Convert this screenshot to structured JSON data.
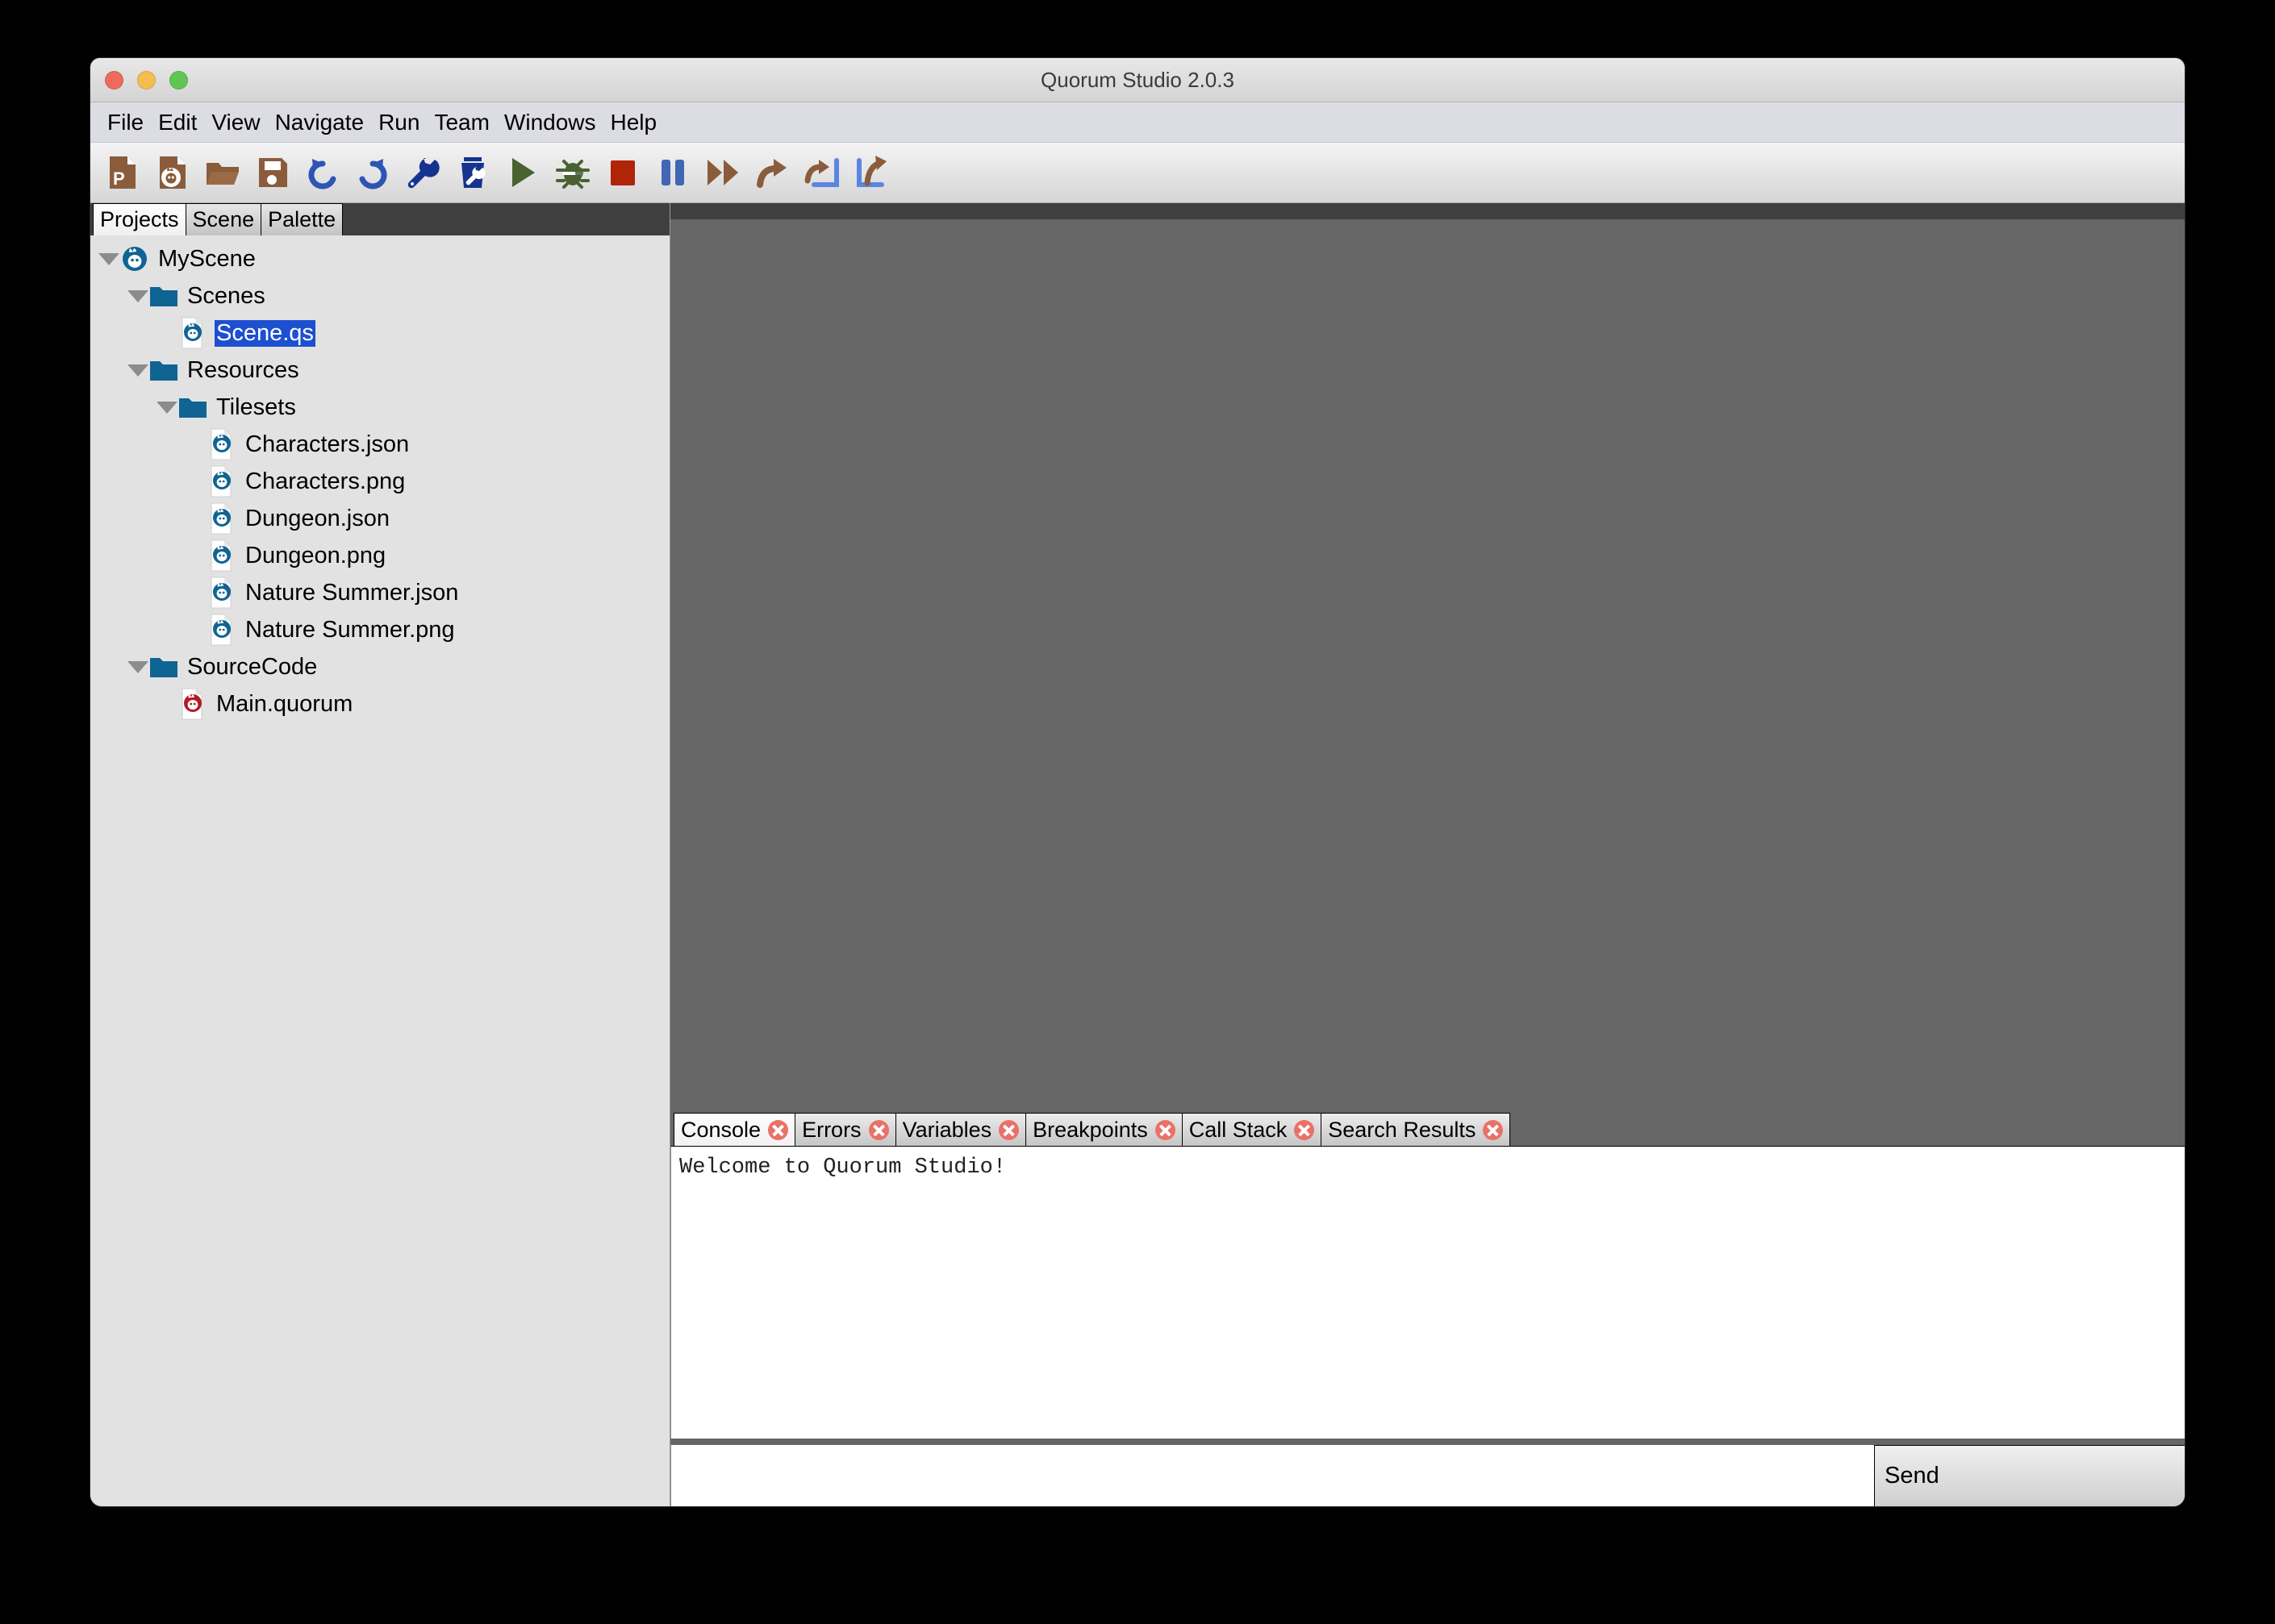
{
  "window": {
    "title": "Quorum Studio 2.0.3",
    "traffic_lights": [
      {
        "name": "close",
        "color": "#ee6a5f"
      },
      {
        "name": "minimize",
        "color": "#f5bd4f"
      },
      {
        "name": "maximize",
        "color": "#61c554"
      }
    ]
  },
  "menubar": {
    "items": [
      "File",
      "Edit",
      "View",
      "Navigate",
      "Run",
      "Team",
      "Windows",
      "Help"
    ]
  },
  "toolbar": {
    "buttons": [
      {
        "name": "new-project-icon",
        "tip": "New Project"
      },
      {
        "name": "new-file-icon",
        "tip": "New File"
      },
      {
        "name": "open-folder-icon",
        "tip": "Open Project"
      },
      {
        "name": "save-icon",
        "tip": "Save"
      },
      {
        "name": "undo-icon",
        "tip": "Undo"
      },
      {
        "name": "redo-icon",
        "tip": "Redo"
      },
      {
        "name": "build-wrench-icon",
        "tip": "Build"
      },
      {
        "name": "clean-build-icon",
        "tip": "Clean and Build"
      },
      {
        "name": "run-play-icon",
        "tip": "Run"
      },
      {
        "name": "debug-bug-icon",
        "tip": "Debug"
      },
      {
        "name": "stop-square-icon",
        "tip": "Stop"
      },
      {
        "name": "pause-icon",
        "tip": "Pause"
      },
      {
        "name": "continue-icon",
        "tip": "Continue"
      },
      {
        "name": "step-over-icon",
        "tip": "Step Over"
      },
      {
        "name": "step-into-icon",
        "tip": "Step Into"
      },
      {
        "name": "step-out-icon",
        "tip": "Step Out"
      }
    ]
  },
  "sidebar": {
    "tabs": [
      {
        "label": "Projects",
        "active": true
      },
      {
        "label": "Scene",
        "active": false
      },
      {
        "label": "Palette",
        "active": false
      }
    ],
    "tree": [
      {
        "label": "MyScene",
        "depth": 0,
        "twisty": "open",
        "icon": "quorum-project-icon",
        "selected": false
      },
      {
        "label": "Scenes",
        "depth": 1,
        "twisty": "open",
        "icon": "folder-icon",
        "selected": false
      },
      {
        "label": "Scene.qs",
        "depth": 2,
        "twisty": "none",
        "icon": "quorum-file-icon",
        "selected": true
      },
      {
        "label": "Resources",
        "depth": 1,
        "twisty": "open",
        "icon": "folder-icon",
        "selected": false
      },
      {
        "label": "Tilesets",
        "depth": 2,
        "twisty": "open",
        "icon": "folder-icon",
        "selected": false
      },
      {
        "label": "Characters.json",
        "depth": 3,
        "twisty": "none",
        "icon": "quorum-file-icon",
        "selected": false
      },
      {
        "label": "Characters.png",
        "depth": 3,
        "twisty": "none",
        "icon": "quorum-file-icon",
        "selected": false
      },
      {
        "label": "Dungeon.json",
        "depth": 3,
        "twisty": "none",
        "icon": "quorum-file-icon",
        "selected": false
      },
      {
        "label": "Dungeon.png",
        "depth": 3,
        "twisty": "none",
        "icon": "quorum-file-icon",
        "selected": false
      },
      {
        "label": "Nature Summer.json",
        "depth": 3,
        "twisty": "none",
        "icon": "quorum-file-icon",
        "selected": false
      },
      {
        "label": "Nature Summer.png",
        "depth": 3,
        "twisty": "none",
        "icon": "quorum-file-icon",
        "selected": false
      },
      {
        "label": "SourceCode",
        "depth": 1,
        "twisty": "open",
        "icon": "folder-icon",
        "selected": false
      },
      {
        "label": "Main.quorum",
        "depth": 2,
        "twisty": "none",
        "icon": "quorum-source-icon",
        "selected": false
      }
    ]
  },
  "bottom_panel": {
    "tabs": [
      {
        "label": "Console",
        "active": true,
        "closable": true
      },
      {
        "label": "Errors",
        "active": false,
        "closable": true
      },
      {
        "label": "Variables",
        "active": false,
        "closable": true
      },
      {
        "label": "Breakpoints",
        "active": false,
        "closable": true
      },
      {
        "label": "Call Stack",
        "active": false,
        "closable": true
      },
      {
        "label": "Search Results",
        "active": false,
        "closable": true
      }
    ],
    "console_output": [
      "Welcome to Quorum Studio!"
    ],
    "console_input_value": "",
    "send_label": "Send"
  },
  "colors": {
    "selection_blue": "#1d4fd1",
    "editor_gray": "#666666",
    "tabstrip_dark": "#3f3f3f",
    "sidebar_bg": "#e2e2e2",
    "menubar_bg": "#dcdce4",
    "close_badge": "#ea7167",
    "quorum_blue": "#0f6493",
    "quorum_red": "#b31b25",
    "icon_brown": "#8a5c3c",
    "icon_blue": "#2d55b5",
    "icon_green": "#4a6132",
    "icon_stop_red": "#b02408"
  }
}
